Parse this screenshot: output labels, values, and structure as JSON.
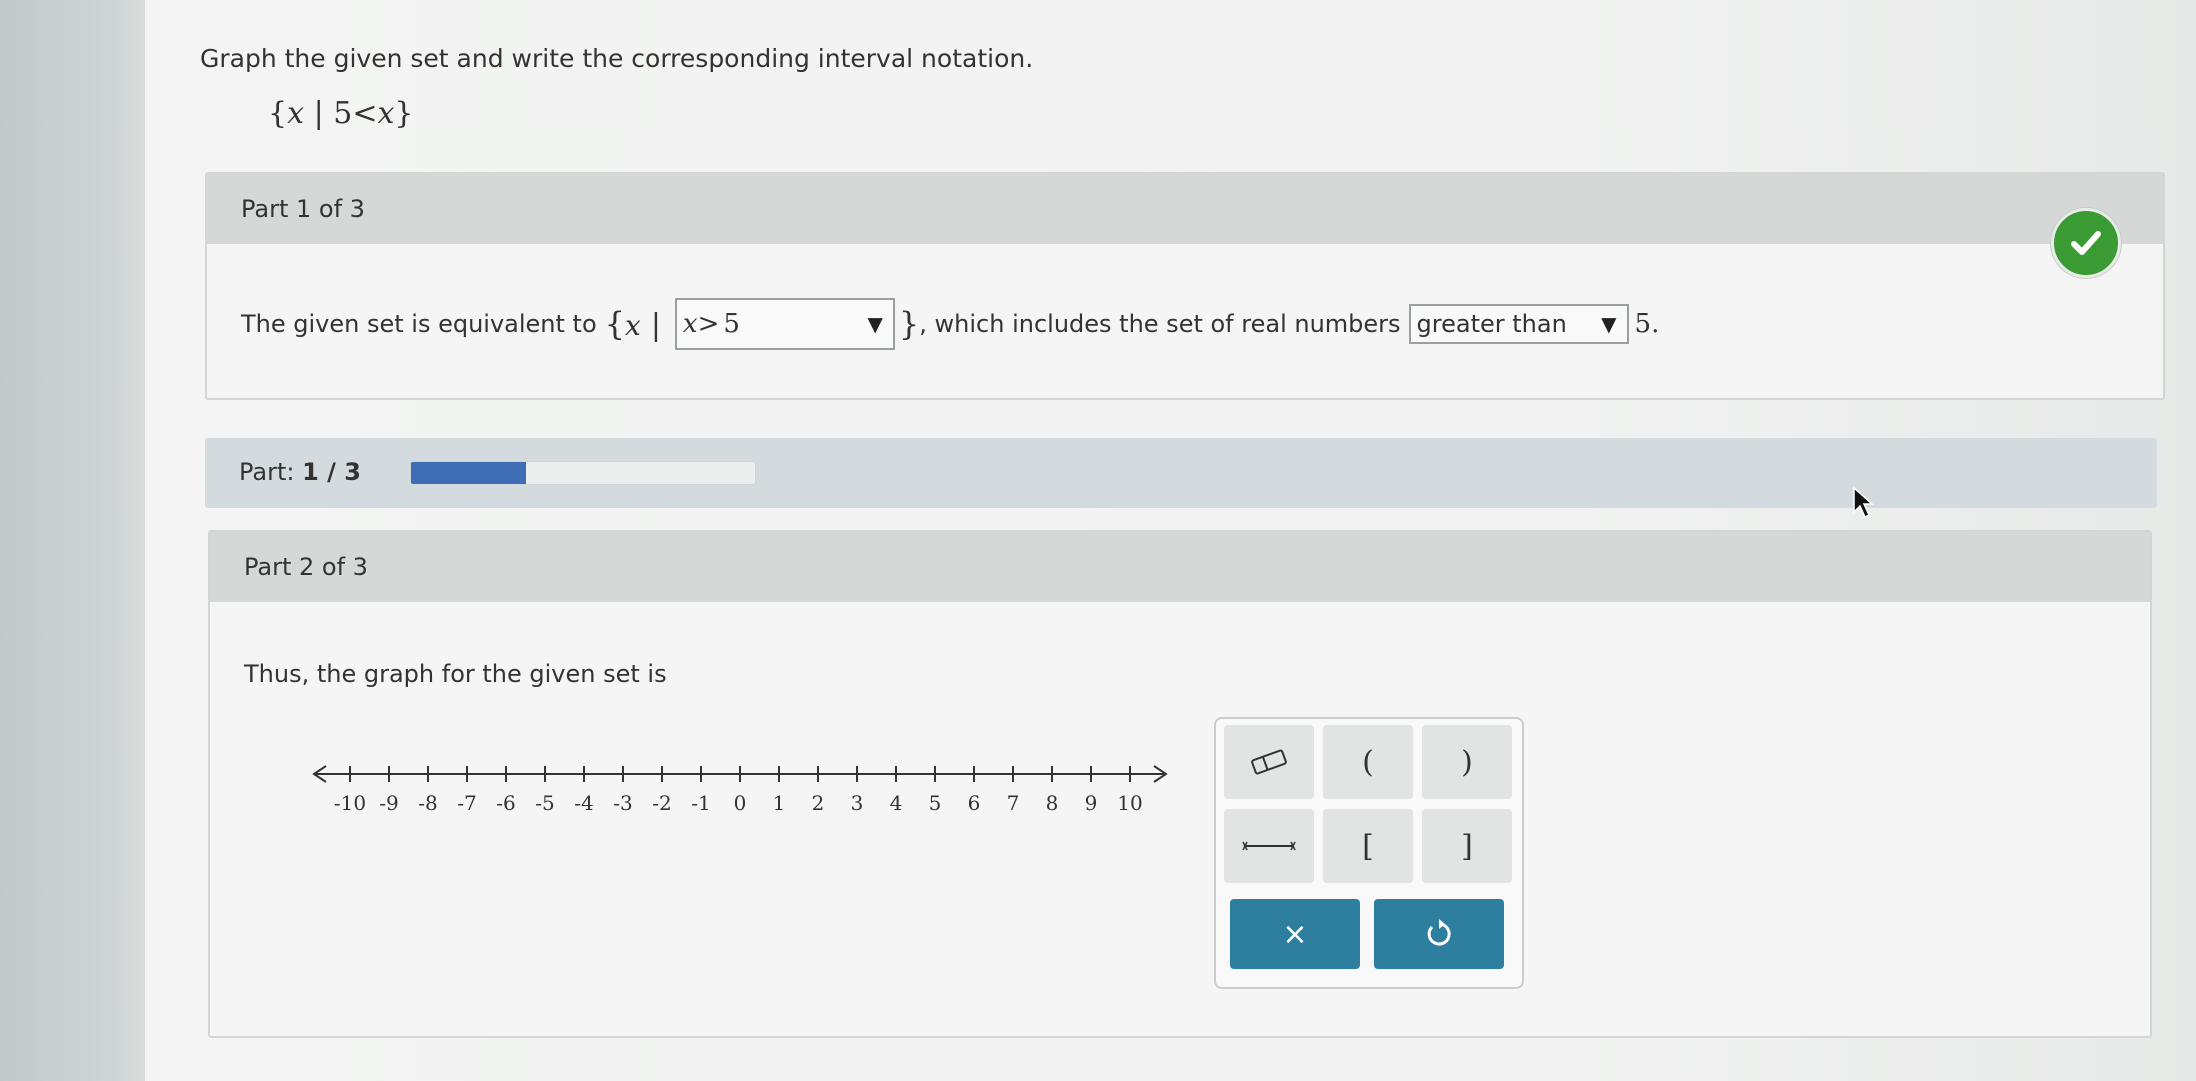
{
  "question": {
    "text": "Graph the given set and write the corresponding interval notation."
  },
  "set_notation": {
    "var": "x",
    "bar": "|",
    "number": "5",
    "op": "<",
    "var2": "x"
  },
  "part1": {
    "header": "Part 1 of 3",
    "status_icon": "check-circle-icon",
    "sentence_start": "The given set is equivalent to",
    "set_var": "x",
    "select1": {
      "var": "x",
      "op": ">",
      "number": "5"
    },
    "sentence_mid": ", which includes the set of real numbers",
    "select2": {
      "value": "greater than"
    },
    "sentence_end": "5."
  },
  "progress": {
    "label": "Part:",
    "value_text": "1 / 3",
    "fraction": 0.333
  },
  "part2": {
    "header": "Part 2 of 3",
    "prompt": "Thus, the graph for the given set is",
    "number_line": {
      "min": -10,
      "max": 10,
      "ticks": [
        "-10",
        "-9",
        "-8",
        "-7",
        "-6",
        "-5",
        "-4",
        "-3",
        "-2",
        "-1",
        "0",
        "1",
        "2",
        "3",
        "4",
        "5",
        "6",
        "7",
        "8",
        "9",
        "10"
      ]
    },
    "tools": {
      "eraser": "eraser-icon",
      "open_left": "(",
      "open_right": ")",
      "segment": "segment-icon",
      "closed_left": "[",
      "closed_right": "]",
      "clear": "×",
      "undo": "undo-icon"
    }
  },
  "colors": {
    "check": "#3a9a34",
    "progress_fill": "#3f6db5",
    "action_button": "#2e7f9f"
  }
}
